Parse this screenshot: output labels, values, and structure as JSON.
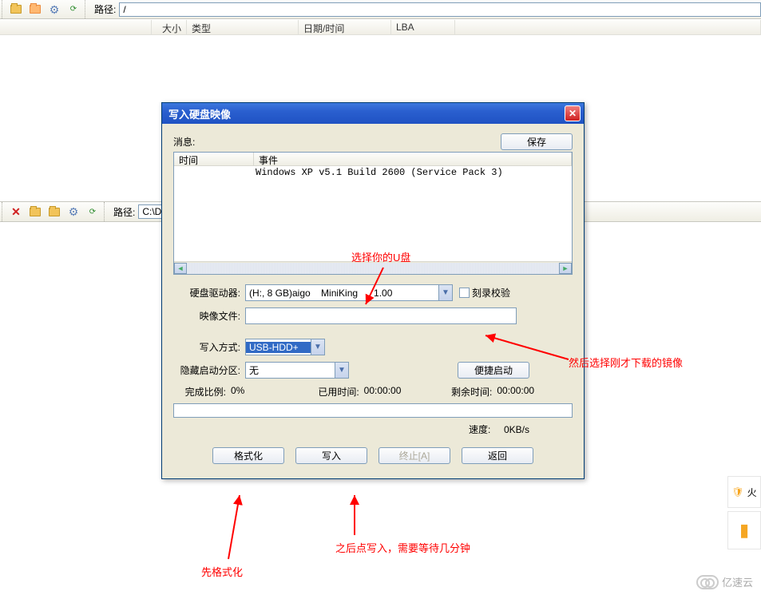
{
  "topbar": {
    "path_label": "路径:",
    "path_value": "/"
  },
  "columns": {
    "size": "大小",
    "type": "类型",
    "datetime": "日期/时间",
    "lba": "LBA"
  },
  "toolbar2": {
    "path_label": "路径:",
    "path_value": "C:\\Doc"
  },
  "dialog": {
    "title": "写入硬盘映像",
    "msg_label": "消息:",
    "save_btn": "保存",
    "list_hdr_time": "时间",
    "list_hdr_event": "事件",
    "event_text": "Windows XP v5.1 Build 2600 (Service Pack 3)",
    "drive_label": "硬盘驱动器:",
    "drive_value": "(H:, 8 GB)aigo    MiniKing      1.00",
    "verify_label": "刻录校验",
    "image_label": "映像文件:",
    "image_value": "",
    "method_label": "写入方式:",
    "method_value": "USB-HDD+",
    "hidden_label": "隐藏启动分区:",
    "hidden_value": "无",
    "quick_boot_btn": "便捷启动",
    "done_label": "完成比例:",
    "done_value": "0%",
    "elapsed_label": "已用时间:",
    "elapsed_value": "00:00:00",
    "remain_label": "剩余时间:",
    "remain_value": "00:00:00",
    "speed_label": "速度:",
    "speed_value": "0KB/s",
    "format_btn": "格式化",
    "write_btn": "写入",
    "stop_btn": "终止[A]",
    "back_btn": "返回"
  },
  "annotations": {
    "a1": "选择你的U盘",
    "a2": "然后选择刚才下载的镜像",
    "a3": "先格式化",
    "a4": "之后点写入，需要等待几分钟"
  },
  "sidebar": {
    "shield_text": "火",
    "brand": "亿速云"
  }
}
